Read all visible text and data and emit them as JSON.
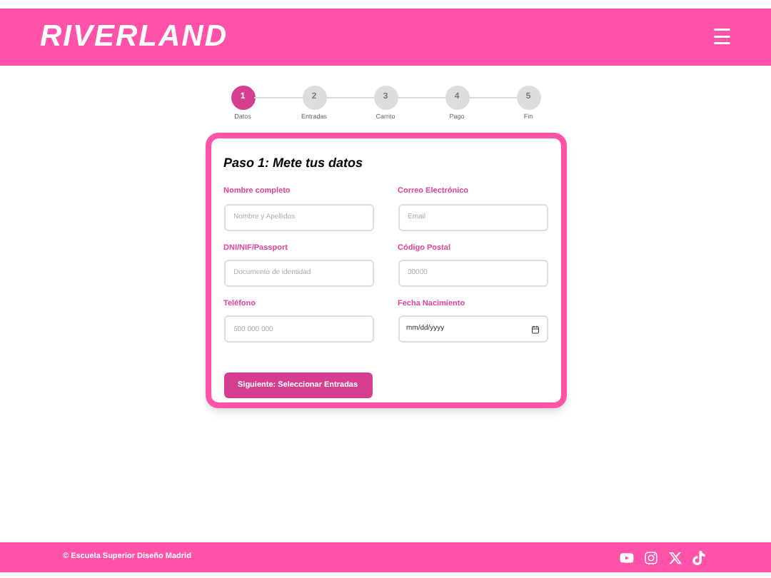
{
  "header": {
    "logo": "RIVERLAND",
    "menu_icon": "☰"
  },
  "steps": [
    {
      "number": "1",
      "label": "Datos",
      "selected": true
    },
    {
      "number": "2",
      "label": "Entradas",
      "selected": false
    },
    {
      "number": "3",
      "label": "Carrito",
      "selected": false
    },
    {
      "number": "4",
      "label": "Pago",
      "selected": false
    },
    {
      "number": "5",
      "label": "Fin",
      "selected": false
    }
  ],
  "form": {
    "title": "Paso 1: Mete tus datos",
    "fields": [
      {
        "label": "Nombre completo",
        "placeholder": "Nombre y Apellidos",
        "kind": "text"
      },
      {
        "label": "Correo Electrónico",
        "placeholder": "Email",
        "kind": "text"
      },
      {
        "label": "DNI/NIF/Passport",
        "placeholder": "Documento de identidad",
        "kind": "text"
      },
      {
        "label": "Código Postal",
        "placeholder": "00000",
        "kind": "text"
      },
      {
        "label": "Teléfono",
        "placeholder": "600 000 000",
        "kind": "text"
      },
      {
        "label": "Fecha Nacimiento",
        "value": "mm/dd/yyyy",
        "kind": "date"
      }
    ],
    "button": "Siguiente: Seleccionar Entradas"
  },
  "footer": {
    "copyright": "© Escuela Superior Diseño Madrid"
  }
}
